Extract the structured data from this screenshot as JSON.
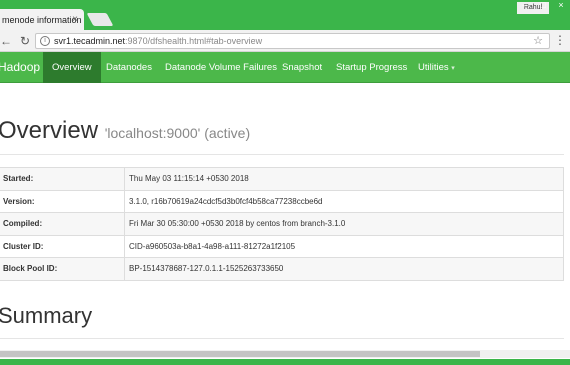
{
  "browser": {
    "tab_title": "menode information",
    "tab_close": "×",
    "user_label": "Rahul",
    "window_buttons": [
      "–",
      "□",
      "×"
    ],
    "url_host": "svr1.tecadmin.net",
    "url_rest": ":9870/dfshealth.html#tab-overview",
    "back_glyph": "←",
    "forward_glyph": "→",
    "reload_glyph": "↻",
    "info_glyph": "i",
    "star_glyph": "☆",
    "menu_glyph": "⋮"
  },
  "nav": {
    "brand": "Hadoop",
    "items": [
      "Overview",
      "Datanodes",
      "Datanode Volume Failures",
      "Snapshot",
      "Startup Progress",
      "Utilities"
    ],
    "active_index": 0,
    "caret": "▾"
  },
  "overview": {
    "title": "Overview",
    "subtitle": "'localhost:9000' (active)",
    "rows": [
      {
        "key": "Started:",
        "value": "Thu May 03 11:15:14 +0530 2018"
      },
      {
        "key": "Version:",
        "value": "3.1.0, r16b70619a24cdcf5d3b0fcf4b58ca77238ccbe6d"
      },
      {
        "key": "Compiled:",
        "value": "Fri Mar 30 05:30:00 +0530 2018 by centos from branch-3.1.0"
      },
      {
        "key": "Cluster ID:",
        "value": "CID-a960503a-b8a1-4a98-a111-81272a1f2105"
      },
      {
        "key": "Block Pool ID:",
        "value": "BP-1514378687-127.0.1.1-1525263733650"
      }
    ]
  },
  "summary": {
    "title": "Summary"
  },
  "colors": {
    "hadoop_green": "#4cb84a",
    "active_tab": "#2d7b2d",
    "chrome_green": "#3bb54a"
  }
}
